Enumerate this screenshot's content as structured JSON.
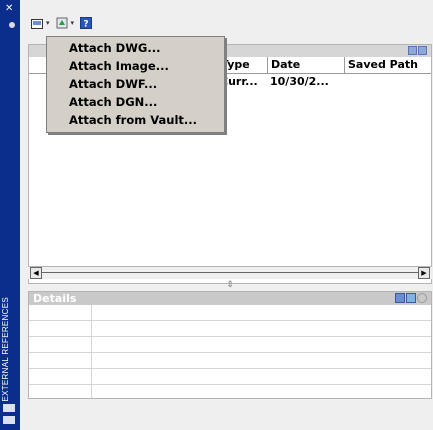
{
  "sidebar": {
    "label": "EXTERNAL REFERENCES",
    "close_glyph": "✕"
  },
  "toolbar": {
    "buttons": [
      {
        "icon": "attach-image-icon"
      },
      {
        "icon": "refresh-icon"
      },
      {
        "icon": "help-icon"
      }
    ]
  },
  "attach_menu": {
    "items": [
      "Attach DWG...",
      "Attach Image...",
      "Attach DWF...",
      "Attach DGN...",
      "Attach from Vault..."
    ]
  },
  "file_references": {
    "columns": [
      "Type",
      "Date",
      "Saved Path"
    ],
    "rows": [
      {
        "type": "Curr...",
        "date": "10/30/2...",
        "saved_path": ""
      }
    ]
  },
  "details": {
    "title": "Details"
  },
  "colors": {
    "sidebar": "#0b2e8c",
    "menu_bg": "#d4d0c8",
    "panel_bg": "#efefef"
  }
}
